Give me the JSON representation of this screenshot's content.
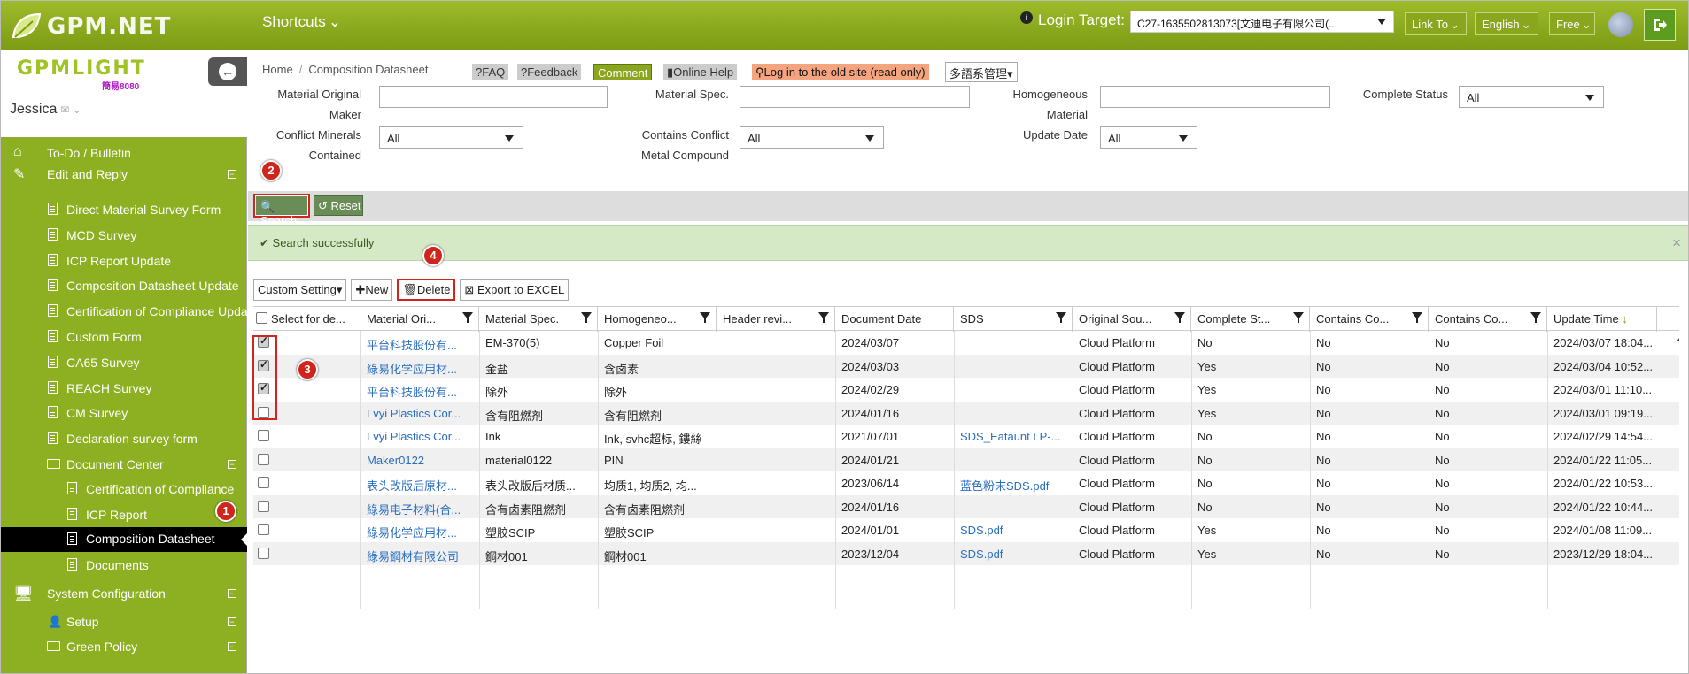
{
  "brand": {
    "name": "GPM.NET",
    "light_name": "GPMLIGHT",
    "light_sub": "簡易8080"
  },
  "header": {
    "shortcuts_label": "Shortcuts",
    "login_target_label": "Login Target:",
    "login_target_value": "C27-1635502813073[文迪电子有限公司(...",
    "link_to_label": "Link To",
    "language_label": "English",
    "free_label": "Free"
  },
  "user": {
    "name": "Jessica"
  },
  "sidebar": {
    "items": [
      {
        "label": "To-Do / Bulletin"
      },
      {
        "label": "Edit and Reply"
      },
      {
        "label": "Direct Material Survey Form"
      },
      {
        "label": "MCD Survey"
      },
      {
        "label": "ICP Report Update"
      },
      {
        "label": "Composition Datasheet Update"
      },
      {
        "label": "Certification of Compliance Upda"
      },
      {
        "label": "Custom Form"
      },
      {
        "label": "CA65 Survey"
      },
      {
        "label": "REACH Survey"
      },
      {
        "label": "CM Survey"
      },
      {
        "label": "Declaration survey form"
      },
      {
        "label": "Document Center"
      },
      {
        "label": "Certification of Compliance"
      },
      {
        "label": "ICP Report"
      },
      {
        "label": "Composition Datasheet"
      },
      {
        "label": "Documents"
      },
      {
        "label": "System Configuration"
      },
      {
        "label": "Setup"
      },
      {
        "label": "Green Policy"
      }
    ]
  },
  "breadcrumb": {
    "home": "Home",
    "current": "Composition Datasheet"
  },
  "toolbar": {
    "faq": "FAQ",
    "feedback": "Feedback",
    "comment": "Comment",
    "online_help": "Online Help",
    "old_site": "Log in to the old site (read only)",
    "multilang": "多語系管理"
  },
  "filters": {
    "material_original_maker_l1": "Material Original",
    "material_original_maker_l2": "Maker",
    "material_spec": "Material Spec.",
    "homogeneous_l1": "Homogeneous",
    "homogeneous_l2": "Material",
    "complete_status": "Complete Status",
    "complete_status_value": "All",
    "conflict_minerals_l1": "Conflict Minerals",
    "conflict_minerals_l2": "Contained",
    "conflict_minerals_value": "All",
    "contains_conflict_l1": "Contains Conflict",
    "contains_conflict_l2": "Metal Compound",
    "contains_conflict_value": "All",
    "update_date": "Update Date",
    "update_date_value": "All"
  },
  "actions": {
    "search": "Search",
    "reset": "Reset"
  },
  "message": {
    "success": "Search successfully"
  },
  "grid_toolbar": {
    "custom_setting": "Custom Setting",
    "new": "New",
    "delete": "Delete",
    "export": "Export to EXCEL"
  },
  "table": {
    "columns": [
      "Select for de...",
      "Material Ori...",
      "Material Spec.",
      "Homogeneo...",
      "Header revi...",
      "Document Date",
      "SDS",
      "Original Sou...",
      "Complete St...",
      "Contains Co...",
      "Contains Co...",
      "Update Time"
    ],
    "rows": [
      {
        "checked": true,
        "maker": "平台科技股份有...",
        "spec": "EM-370(5)",
        "homog": "Copper Foil",
        "header_rev": "",
        "doc_date": "2024/03/07",
        "sds": "",
        "source": "Cloud Platform",
        "complete": "No",
        "cc1": "No",
        "cc2": "No",
        "update": "2024/03/07 18:04..."
      },
      {
        "checked": true,
        "maker": "綠易化学应用材...",
        "spec": "金盐",
        "homog": "含卤素",
        "header_rev": "",
        "doc_date": "2024/03/03",
        "sds": "",
        "source": "Cloud Platform",
        "complete": "Yes",
        "cc1": "No",
        "cc2": "No",
        "update": "2024/03/04 10:52..."
      },
      {
        "checked": true,
        "maker": "平台科技股份有...",
        "spec": "除外",
        "homog": "除外",
        "header_rev": "",
        "doc_date": "2024/02/29",
        "sds": "",
        "source": "Cloud Platform",
        "complete": "Yes",
        "cc1": "No",
        "cc2": "No",
        "update": "2024/03/01 11:10..."
      },
      {
        "checked": false,
        "maker": "Lvyi Plastics Cor...",
        "spec": "含有阻燃剂",
        "homog": "含有阻燃剂",
        "header_rev": "",
        "doc_date": "2024/01/16",
        "sds": "",
        "source": "Cloud Platform",
        "complete": "Yes",
        "cc1": "No",
        "cc2": "No",
        "update": "2024/03/01 09:19..."
      },
      {
        "checked": false,
        "maker": "Lvyi Plastics Cor...",
        "spec": "Ink",
        "homog": "Ink, svhc超标, 鏤絲",
        "header_rev": "",
        "doc_date": "2021/07/01",
        "sds": "SDS_Eataunt LP-...",
        "source": "Cloud Platform",
        "complete": "No",
        "cc1": "No",
        "cc2": "No",
        "update": "2024/02/29 14:54..."
      },
      {
        "checked": false,
        "maker": "Maker0122",
        "spec": "material0122",
        "homog": "PIN",
        "header_rev": "",
        "doc_date": "2024/01/21",
        "sds": "",
        "source": "Cloud Platform",
        "complete": "No",
        "cc1": "No",
        "cc2": "No",
        "update": "2024/01/22 11:05..."
      },
      {
        "checked": false,
        "maker": "表头改版后原材...",
        "spec": "表头改版后材质...",
        "homog": "均质1, 均质2, 均...",
        "header_rev": "",
        "doc_date": "2023/06/14",
        "sds": "蓝色粉末SDS.pdf",
        "source": "Cloud Platform",
        "complete": "No",
        "cc1": "No",
        "cc2": "No",
        "update": "2024/01/22 10:53..."
      },
      {
        "checked": false,
        "maker": "綠易电子材料(合...",
        "spec": "含有卤素阻燃剂",
        "homog": "含有卤素阻燃剂",
        "header_rev": "",
        "doc_date": "2024/01/16",
        "sds": "",
        "source": "Cloud Platform",
        "complete": "No",
        "cc1": "No",
        "cc2": "No",
        "update": "2024/01/22 10:44..."
      },
      {
        "checked": false,
        "maker": "綠易化学应用材...",
        "spec": "塑胶SCIP",
        "homog": "塑胶SCIP",
        "header_rev": "",
        "doc_date": "2024/01/01",
        "sds": "SDS.pdf",
        "source": "Cloud Platform",
        "complete": "Yes",
        "cc1": "No",
        "cc2": "No",
        "update": "2024/01/08 11:09..."
      },
      {
        "checked": false,
        "maker": "綠易鋼材有限公司",
        "spec": "鋼材001",
        "homog": "鋼材001",
        "header_rev": "",
        "doc_date": "2023/12/04",
        "sds": "SDS.pdf",
        "source": "Cloud Platform",
        "complete": "Yes",
        "cc1": "No",
        "cc2": "No",
        "update": "2023/12/29 18:04..."
      }
    ]
  },
  "annotations": {
    "step1": "1",
    "step2": "2",
    "step3": "3",
    "step4": "4"
  },
  "colors": {
    "brand_green": "#8cb021",
    "marker_red": "#d0251d",
    "link_blue": "#2a6ebf"
  }
}
